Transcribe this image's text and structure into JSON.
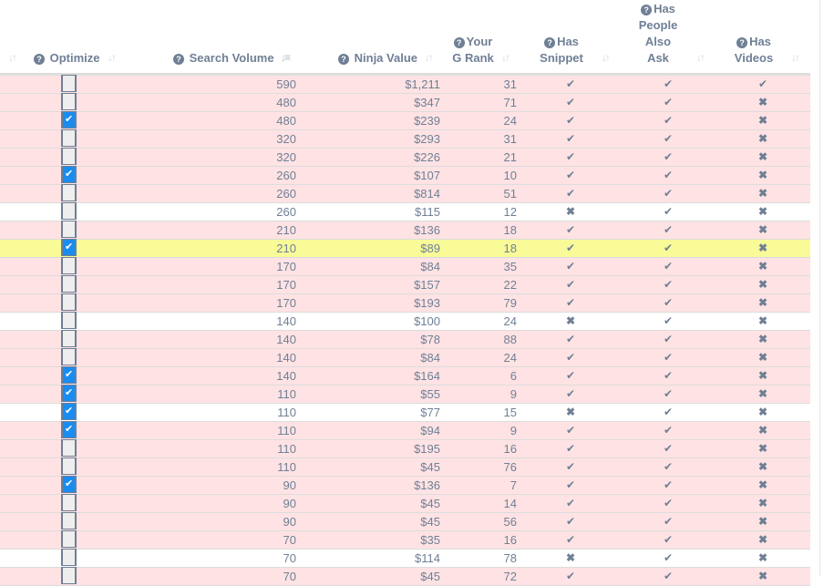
{
  "header": {
    "optimize": "Optimize",
    "search_volume": "Search Volume",
    "ninja_value": "Ninja Value",
    "g_rank_line1": "Your",
    "g_rank_line2": "G Rank",
    "snippet_line1": "Has",
    "snippet_line2": "Snippet",
    "paa_line1": "Has",
    "paa_line2": "People",
    "paa_line3": "Also",
    "paa_line4": "Ask",
    "videos_line1": "Has",
    "videos_line2": "Videos",
    "help_glyph": "?",
    "sort_glyph": "↓↑",
    "sort_active_glyph": "↓≡"
  },
  "colors": {
    "row_pink": "#ffe3e4",
    "row_white": "#ffffff",
    "row_yellow": "#f8fb98",
    "checkbox_on": "#1a8cf0",
    "text": "#6f7f95"
  },
  "icons": {
    "check": "✔",
    "cross": "✖"
  },
  "rows": [
    {
      "bg": "pink",
      "optimize": false,
      "search_volume": "590",
      "ninja_value": "$1,211",
      "g_rank": "31",
      "snippet": true,
      "paa": true,
      "videos": true
    },
    {
      "bg": "pink",
      "optimize": false,
      "search_volume": "480",
      "ninja_value": "$347",
      "g_rank": "71",
      "snippet": true,
      "paa": true,
      "videos": false
    },
    {
      "bg": "pink",
      "optimize": true,
      "search_volume": "480",
      "ninja_value": "$239",
      "g_rank": "24",
      "snippet": true,
      "paa": true,
      "videos": false
    },
    {
      "bg": "pink",
      "optimize": false,
      "search_volume": "320",
      "ninja_value": "$293",
      "g_rank": "31",
      "snippet": true,
      "paa": true,
      "videos": false
    },
    {
      "bg": "pink",
      "optimize": false,
      "search_volume": "320",
      "ninja_value": "$226",
      "g_rank": "21",
      "snippet": true,
      "paa": true,
      "videos": false
    },
    {
      "bg": "pink",
      "optimize": true,
      "search_volume": "260",
      "ninja_value": "$107",
      "g_rank": "10",
      "snippet": true,
      "paa": true,
      "videos": false
    },
    {
      "bg": "pink",
      "optimize": false,
      "search_volume": "260",
      "ninja_value": "$814",
      "g_rank": "51",
      "snippet": true,
      "paa": true,
      "videos": false
    },
    {
      "bg": "white",
      "optimize": false,
      "search_volume": "260",
      "ninja_value": "$115",
      "g_rank": "12",
      "snippet": false,
      "paa": true,
      "videos": false
    },
    {
      "bg": "pink",
      "optimize": false,
      "search_volume": "210",
      "ninja_value": "$136",
      "g_rank": "18",
      "snippet": true,
      "paa": true,
      "videos": false
    },
    {
      "bg": "yellow",
      "optimize": true,
      "search_volume": "210",
      "ninja_value": "$89",
      "g_rank": "18",
      "snippet": true,
      "paa": true,
      "videos": false
    },
    {
      "bg": "pink",
      "optimize": false,
      "search_volume": "170",
      "ninja_value": "$84",
      "g_rank": "35",
      "snippet": true,
      "paa": true,
      "videos": false
    },
    {
      "bg": "pink",
      "optimize": false,
      "search_volume": "170",
      "ninja_value": "$157",
      "g_rank": "22",
      "snippet": true,
      "paa": true,
      "videos": false
    },
    {
      "bg": "pink",
      "optimize": false,
      "search_volume": "170",
      "ninja_value": "$193",
      "g_rank": "79",
      "snippet": true,
      "paa": true,
      "videos": false
    },
    {
      "bg": "white",
      "optimize": false,
      "search_volume": "140",
      "ninja_value": "$100",
      "g_rank": "24",
      "snippet": false,
      "paa": true,
      "videos": false
    },
    {
      "bg": "pink",
      "optimize": false,
      "search_volume": "140",
      "ninja_value": "$78",
      "g_rank": "88",
      "snippet": true,
      "paa": true,
      "videos": false
    },
    {
      "bg": "pink",
      "optimize": false,
      "search_volume": "140",
      "ninja_value": "$84",
      "g_rank": "24",
      "snippet": true,
      "paa": true,
      "videos": false
    },
    {
      "bg": "pink",
      "optimize": true,
      "search_volume": "140",
      "ninja_value": "$164",
      "g_rank": "6",
      "snippet": true,
      "paa": true,
      "videos": false
    },
    {
      "bg": "pink",
      "optimize": true,
      "search_volume": "110",
      "ninja_value": "$55",
      "g_rank": "9",
      "snippet": true,
      "paa": true,
      "videos": false
    },
    {
      "bg": "white",
      "optimize": true,
      "search_volume": "110",
      "ninja_value": "$77",
      "g_rank": "15",
      "snippet": false,
      "paa": true,
      "videos": false
    },
    {
      "bg": "pink",
      "optimize": true,
      "search_volume": "110",
      "ninja_value": "$94",
      "g_rank": "9",
      "snippet": true,
      "paa": true,
      "videos": false
    },
    {
      "bg": "pink",
      "optimize": false,
      "search_volume": "110",
      "ninja_value": "$195",
      "g_rank": "16",
      "snippet": true,
      "paa": true,
      "videos": false
    },
    {
      "bg": "pink",
      "optimize": false,
      "search_volume": "110",
      "ninja_value": "$45",
      "g_rank": "76",
      "snippet": true,
      "paa": true,
      "videos": false
    },
    {
      "bg": "pink",
      "optimize": true,
      "search_volume": "90",
      "ninja_value": "$136",
      "g_rank": "7",
      "snippet": true,
      "paa": true,
      "videos": false
    },
    {
      "bg": "pink",
      "optimize": false,
      "search_volume": "90",
      "ninja_value": "$45",
      "g_rank": "14",
      "snippet": true,
      "paa": true,
      "videos": false
    },
    {
      "bg": "pink",
      "optimize": false,
      "search_volume": "90",
      "ninja_value": "$45",
      "g_rank": "56",
      "snippet": true,
      "paa": true,
      "videos": false
    },
    {
      "bg": "pink",
      "optimize": false,
      "search_volume": "70",
      "ninja_value": "$35",
      "g_rank": "16",
      "snippet": true,
      "paa": true,
      "videos": false
    },
    {
      "bg": "white",
      "optimize": false,
      "search_volume": "70",
      "ninja_value": "$114",
      "g_rank": "78",
      "snippet": false,
      "paa": true,
      "videos": false
    },
    {
      "bg": "pink",
      "optimize": false,
      "search_volume": "70",
      "ninja_value": "$45",
      "g_rank": "72",
      "snippet": true,
      "paa": true,
      "videos": false
    }
  ]
}
